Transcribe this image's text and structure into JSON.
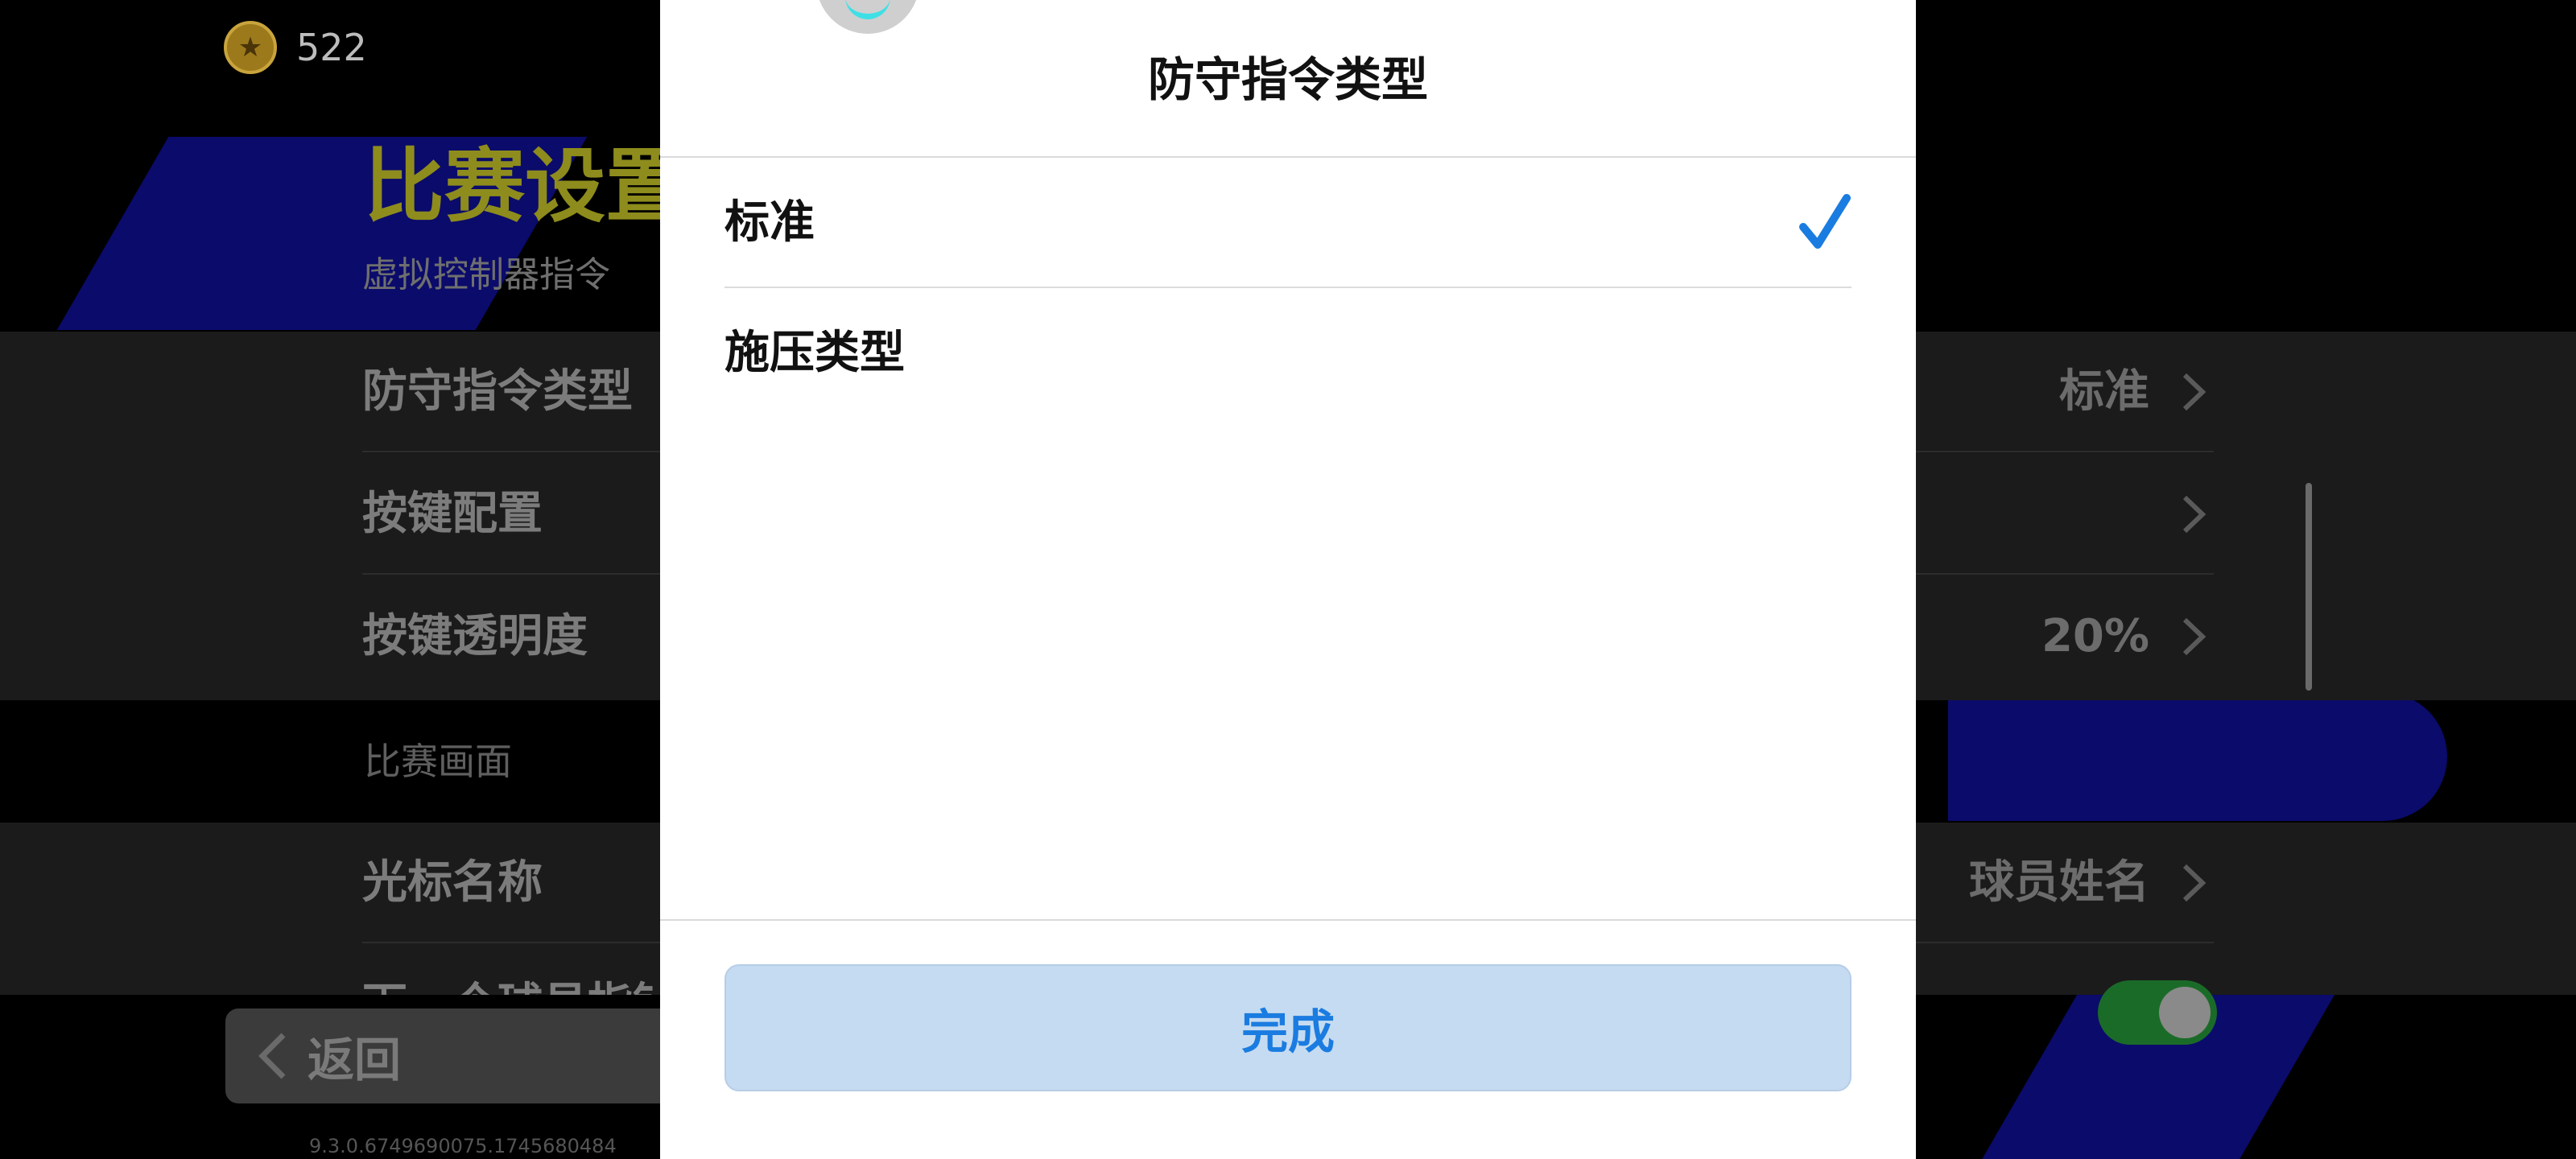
{
  "header": {
    "coin_icon": "star-coin-icon",
    "coin_count": "522"
  },
  "background": {
    "page_title": "比赛设置",
    "subtitle": "虚拟控制器指令",
    "rows": [
      {
        "label": "防守指令类型",
        "value": "标准"
      },
      {
        "label": "按键配置",
        "value": ""
      },
      {
        "label": "按键透明度",
        "value": "20%"
      }
    ],
    "section_label": "比赛画面",
    "rows2": [
      {
        "label": "光标名称",
        "value": "球员姓名"
      },
      {
        "label": "下一个球员指针"
      }
    ],
    "back_label": "返回",
    "version": "9.3.0.6749690075.1745680484"
  },
  "modal": {
    "title": "防守指令类型",
    "options": [
      {
        "label": "标准",
        "selected": true
      },
      {
        "label": "施压类型",
        "selected": false
      }
    ],
    "done_label": "完成",
    "accent_color": "#1a7ce0"
  }
}
